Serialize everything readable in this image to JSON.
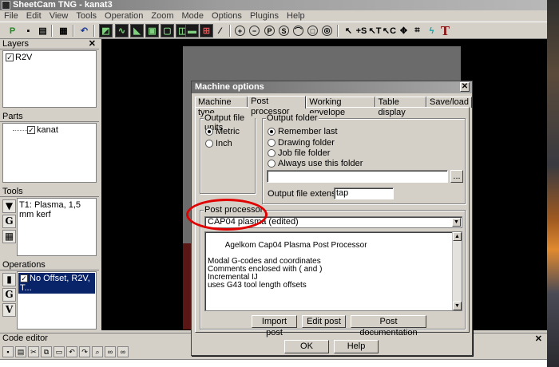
{
  "window": {
    "title": "SheetCam TNG - kanat3"
  },
  "menu": [
    "File",
    "Edit",
    "View",
    "Tools",
    "Operation",
    "Zoom",
    "Mode",
    "Options",
    "Plugins",
    "Help"
  ],
  "toolbar": {
    "icons": [
      "post-process-icon",
      "save-icon",
      "print-icon",
      "table-icon",
      "undo-icon"
    ]
  },
  "layers": {
    "title": "Layers",
    "items": [
      {
        "label": "R2V",
        "checked": true
      }
    ]
  },
  "parts": {
    "title": "Parts",
    "items": [
      {
        "label": "kanat",
        "checked": true
      }
    ]
  },
  "tools": {
    "title": "Tools",
    "items": [
      {
        "label": "T1: Plasma, 1,5 mm kerf"
      }
    ]
  },
  "operations": {
    "title": "Operations",
    "items": [
      {
        "label": "No Offset, R2V, T...",
        "checked": true
      }
    ]
  },
  "code_editor": {
    "title": "Code editor"
  },
  "dialog": {
    "title": "Machine options",
    "tabs": [
      "Machine type",
      "Post processor",
      "Working envelope",
      "Table display",
      "Save/load"
    ],
    "active_tab": "Post processor",
    "output_units": {
      "label": "Output file units",
      "options": [
        "Metric",
        "Inch"
      ],
      "selected": "Metric"
    },
    "output_folder": {
      "label": "Output folder",
      "options": [
        "Remember last",
        "Drawing folder",
        "Job file folder",
        "Always use this folder"
      ],
      "selected": "Remember last",
      "path_value": "",
      "browse_label": "...",
      "extension_label": "Output file extension",
      "extension_value": "tap"
    },
    "post_processor": {
      "label": "Post processor",
      "selected": "CAP04 plasma (edited)",
      "description": "Agelkom Cap04 Plasma Post Processor\n\nModal G-codes and coordinates\nComments enclosed with ( and )\nIncremental IJ\nuses G43 tool length offsets"
    },
    "buttons": {
      "import": "Import post",
      "edit": "Edit post",
      "documentation": "Post documentation",
      "ok": "OK",
      "help": "Help"
    },
    "close_glyph": "✕"
  }
}
